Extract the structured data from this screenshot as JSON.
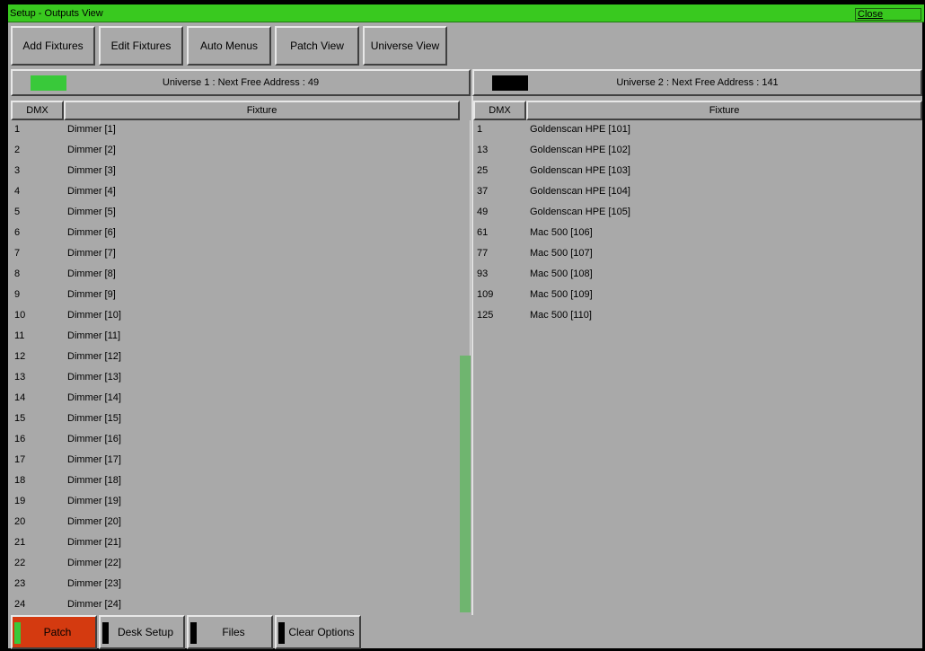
{
  "window": {
    "title": "Setup - Outputs View",
    "close_label": "Close"
  },
  "toolbar": [
    {
      "label": "Add Fixtures"
    },
    {
      "label": "Edit Fixtures"
    },
    {
      "label": "Auto Menus"
    },
    {
      "label": "Patch View"
    },
    {
      "label": "Universe View"
    }
  ],
  "universes": [
    {
      "label": "Universe 1 : Next Free Address : 49",
      "swatch_color": "#39c93a",
      "columns": {
        "dmx": "DMX",
        "fixture": "Fixture"
      },
      "rows": [
        {
          "dmx": "1",
          "fixture": "Dimmer [1]"
        },
        {
          "dmx": "2",
          "fixture": "Dimmer [2]"
        },
        {
          "dmx": "3",
          "fixture": "Dimmer [3]"
        },
        {
          "dmx": "4",
          "fixture": "Dimmer [4]"
        },
        {
          "dmx": "5",
          "fixture": "Dimmer [5]"
        },
        {
          "dmx": "6",
          "fixture": "Dimmer [6]"
        },
        {
          "dmx": "7",
          "fixture": "Dimmer [7]"
        },
        {
          "dmx": "8",
          "fixture": "Dimmer [8]"
        },
        {
          "dmx": "9",
          "fixture": "Dimmer [9]"
        },
        {
          "dmx": "10",
          "fixture": "Dimmer [10]"
        },
        {
          "dmx": "11",
          "fixture": "Dimmer [11]"
        },
        {
          "dmx": "12",
          "fixture": "Dimmer [12]"
        },
        {
          "dmx": "13",
          "fixture": "Dimmer [13]"
        },
        {
          "dmx": "14",
          "fixture": "Dimmer [14]"
        },
        {
          "dmx": "15",
          "fixture": "Dimmer [15]"
        },
        {
          "dmx": "16",
          "fixture": "Dimmer [16]"
        },
        {
          "dmx": "17",
          "fixture": "Dimmer [17]"
        },
        {
          "dmx": "18",
          "fixture": "Dimmer [18]"
        },
        {
          "dmx": "19",
          "fixture": "Dimmer [19]"
        },
        {
          "dmx": "20",
          "fixture": "Dimmer [20]"
        },
        {
          "dmx": "21",
          "fixture": "Dimmer [21]"
        },
        {
          "dmx": "22",
          "fixture": "Dimmer [22]"
        },
        {
          "dmx": "23",
          "fixture": "Dimmer [23]"
        },
        {
          "dmx": "24",
          "fixture": "Dimmer [24]"
        }
      ]
    },
    {
      "label": "Universe 2 : Next Free Address : 141",
      "swatch_color": "#000000",
      "columns": {
        "dmx": "DMX",
        "fixture": "Fixture"
      },
      "rows": [
        {
          "dmx": "1",
          "fixture": "Goldenscan HPE [101]"
        },
        {
          "dmx": "13",
          "fixture": "Goldenscan HPE [102]"
        },
        {
          "dmx": "25",
          "fixture": "Goldenscan HPE [103]"
        },
        {
          "dmx": "37",
          "fixture": "Goldenscan HPE [104]"
        },
        {
          "dmx": "49",
          "fixture": "Goldenscan HPE [105]"
        },
        {
          "dmx": "61",
          "fixture": "Mac 500 [106]"
        },
        {
          "dmx": "77",
          "fixture": "Mac 500 [107]"
        },
        {
          "dmx": "93",
          "fixture": "Mac 500 [108]"
        },
        {
          "dmx": "109",
          "fixture": "Mac 500 [109]"
        },
        {
          "dmx": "125",
          "fixture": "Mac 500 [110]"
        }
      ]
    }
  ],
  "bottom_bar": [
    {
      "label": "Patch",
      "indicator_color": "#39c93a",
      "bg_color": "#d43a10",
      "active": true
    },
    {
      "label": "Desk Setup",
      "indicator_color": "#000000",
      "bg_color": "#a9a9a9",
      "active": false
    },
    {
      "label": "Files",
      "indicator_color": "#000000",
      "bg_color": "#a9a9a9",
      "active": false
    },
    {
      "label": "Clear Options",
      "indicator_color": "#000000",
      "bg_color": "#a9a9a9",
      "active": false
    }
  ]
}
